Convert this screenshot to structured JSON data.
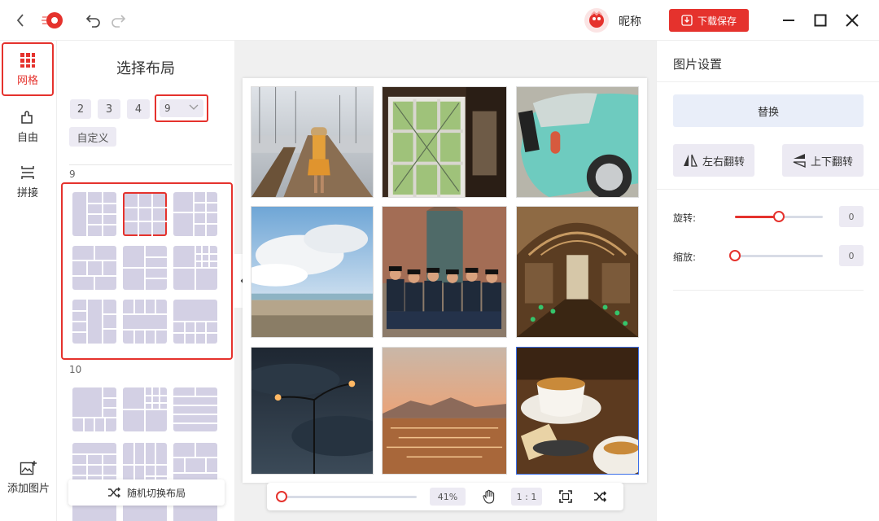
{
  "header": {
    "username": "昵称",
    "download_label": "下载保存"
  },
  "left_nav": [
    {
      "label": "网格",
      "active": true,
      "icon": "grid-icon"
    },
    {
      "label": "自由",
      "active": false,
      "icon": "puzzle-icon"
    },
    {
      "label": "拼接",
      "active": false,
      "icon": "stitch-icon"
    },
    {
      "label": "添加图片",
      "active": false,
      "icon": "add-image-icon"
    }
  ],
  "layout_panel": {
    "title": "选择布局",
    "counts": [
      "2",
      "3",
      "4"
    ],
    "selected_count": "9",
    "custom_label": "自定义",
    "section_9_label": "9",
    "section_10_label": "10",
    "random_label": "随机切换布局"
  },
  "canvas": {
    "zoom_label": "41%",
    "ratio_label": "1 : 1",
    "zoom_level": 0.0
  },
  "settings": {
    "title": "图片设置",
    "replace_label": "替换",
    "flip_h_label": "左右翻转",
    "flip_v_label": "上下翻转",
    "rotate_label": "旋转:",
    "rotate_value": "0",
    "rotate_level": 0.5,
    "scale_label": "缩放:",
    "scale_value": "0",
    "scale_level": 0.0
  },
  "colors": {
    "accent": "#e5322d",
    "thumb": "#d3d0e4",
    "chip": "#eceaf3"
  }
}
